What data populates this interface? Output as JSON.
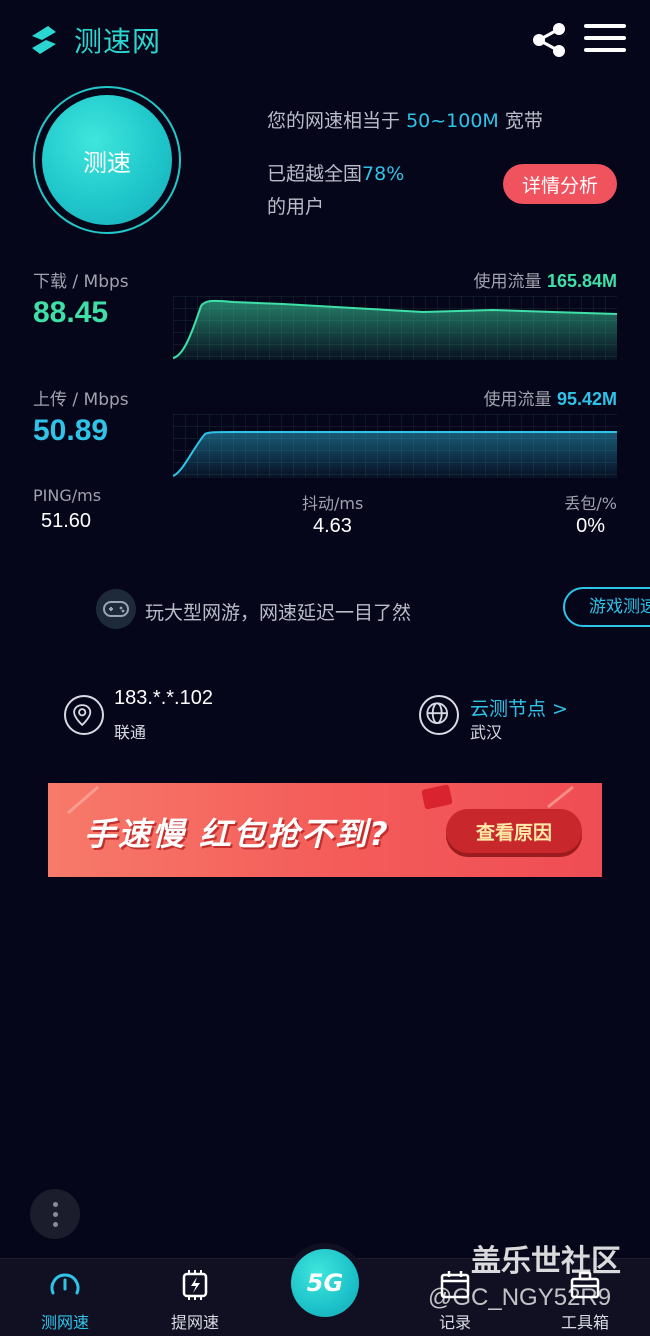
{
  "header": {
    "app_title": "测速网",
    "logo_icon": "s-logo-icon",
    "share_icon": "share-icon",
    "menu_icon": "hamburger-menu-icon"
  },
  "speed_test": {
    "button_label": "测速",
    "result_prefix": "您的网速相当于",
    "bandwidth": "50~100M",
    "result_suffix": "宽带",
    "rank_prefix": "已超越全国",
    "rank_percent": "78%",
    "rank_suffix": "的用户",
    "detail_button": "详情分析"
  },
  "download": {
    "label": "下载 / Mbps",
    "value": "88.45",
    "usage_label": "使用流量",
    "usage_value": "165.84M",
    "color": "#3ee0a8"
  },
  "upload": {
    "label": "上传 / Mbps",
    "value": "50.89",
    "usage_label": "使用流量",
    "usage_value": "95.42M",
    "color": "#2fc3e8"
  },
  "stats": {
    "ping_label": "PING/ms",
    "ping_value": "51.60",
    "jitter_label": "抖动/ms",
    "jitter_value": "4.63",
    "loss_label": "丢包/%",
    "loss_value": "0%"
  },
  "game_promo": {
    "icon": "gamepad-icon",
    "text": "玩大型网游，网速延迟一目了然",
    "button": "游戏测速"
  },
  "connection": {
    "ip": "183.*.*.102",
    "isp": "联通",
    "node_link": "云测节点 >",
    "node_city": "武汉"
  },
  "ad_banner": {
    "title": "手速慢 红包抢不到?",
    "button": "查看原因"
  },
  "bottom_nav": {
    "items": [
      {
        "label": "测网速",
        "icon": "speedometer-icon"
      },
      {
        "label": "提网速",
        "icon": "boost-chip-icon"
      },
      {
        "label": "5G",
        "icon": "5g-icon"
      },
      {
        "label": "记录",
        "icon": "calendar-record-icon"
      },
      {
        "label": "工具箱",
        "icon": "toolbox-icon"
      }
    ]
  },
  "watermark": {
    "line1": "盖乐世社区",
    "line2": "@GC_NGY52R9"
  },
  "colors": {
    "background": "#06061a",
    "accent_cyan": "#2fc3e8",
    "accent_green": "#3ee0a8",
    "detail_red": "#f0525e"
  }
}
